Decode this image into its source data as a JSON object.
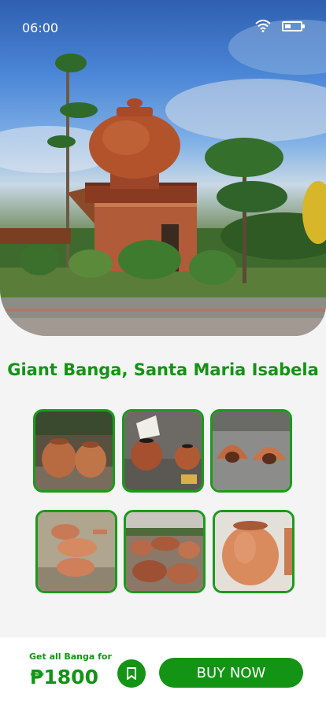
{
  "status_bar": {
    "time": "06:00"
  },
  "place": {
    "title": "Giant Banga, Santa Maria Isabela"
  },
  "gallery": {
    "items": [
      {
        "name": "gallery-thumb-two-bangas"
      },
      {
        "name": "gallery-thumb-painted-jars"
      },
      {
        "name": "gallery-thumb-clay-stoves"
      },
      {
        "name": "gallery-thumb-clay-pots-row"
      },
      {
        "name": "gallery-thumb-pottery-pile"
      },
      {
        "name": "gallery-thumb-large-jar"
      }
    ]
  },
  "purchase": {
    "caption": "Get all Banga for",
    "price": "₱1800",
    "buy_label": "BUY NOW"
  },
  "colors": {
    "accent": "#139414",
    "background": "#f4f4f4"
  }
}
